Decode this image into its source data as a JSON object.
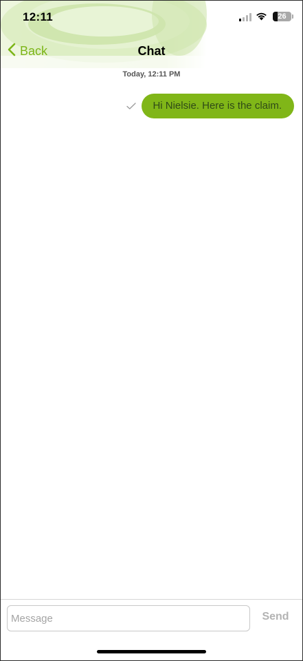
{
  "status_bar": {
    "time": "12:11",
    "battery_level": "26"
  },
  "nav": {
    "back_label": "Back",
    "title": "Chat"
  },
  "conversation": {
    "timestamp": "Today, 12:11 PM",
    "messages": [
      {
        "text": "Hi Nielsie. Here is the claim.",
        "direction": "outgoing",
        "status_icon": "check-icon"
      }
    ]
  },
  "composer": {
    "placeholder": "Message",
    "value": "",
    "send_label": "Send"
  },
  "colors": {
    "accent": "#7cb518",
    "bubble": "#80b618",
    "send_disabled": "#b3b3b3"
  }
}
